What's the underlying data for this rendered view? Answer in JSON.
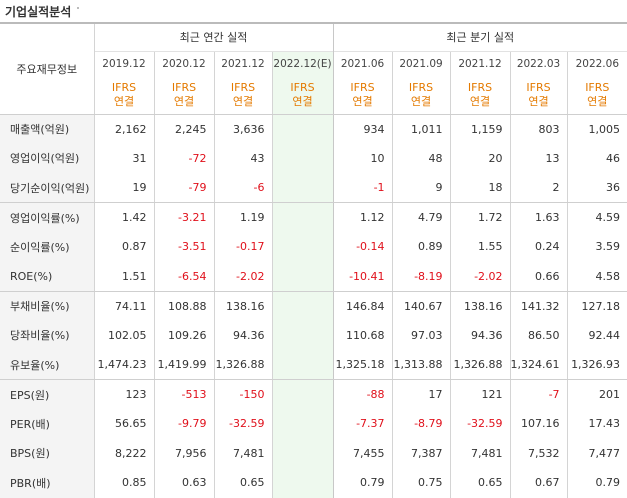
{
  "section_title": "기업실적분석",
  "corner_label": "주요재무정보",
  "annual_header": "최근 연간 실적",
  "quarter_header": "최근 분기 실적",
  "annual_periods": [
    "2019.12",
    "2020.12",
    "2021.12",
    "2022.12(E)"
  ],
  "quarter_periods": [
    "2021.06",
    "2021.09",
    "2021.12",
    "2022.03",
    "2022.06"
  ],
  "ifrs_top": "IFRS",
  "ifrs_bottom": "연결",
  "rows": [
    {
      "label": "매출액(억원)",
      "annual": [
        "2,162",
        "2,245",
        "3,636",
        ""
      ],
      "quarter": [
        "934",
        "1,011",
        "1,159",
        "803",
        "1,005"
      ]
    },
    {
      "label": "영업이익(억원)",
      "annual": [
        "31",
        "-72",
        "43",
        ""
      ],
      "quarter": [
        "10",
        "48",
        "20",
        "13",
        "46"
      ]
    },
    {
      "label": "당기순이익(억원)",
      "annual": [
        "19",
        "-79",
        "-6",
        ""
      ],
      "quarter": [
        "-1",
        "9",
        "18",
        "2",
        "36"
      ]
    },
    {
      "label": "영업이익률(%)",
      "annual": [
        "1.42",
        "-3.21",
        "1.19",
        ""
      ],
      "quarter": [
        "1.12",
        "4.79",
        "1.72",
        "1.63",
        "4.59"
      ]
    },
    {
      "label": "순이익률(%)",
      "annual": [
        "0.87",
        "-3.51",
        "-0.17",
        ""
      ],
      "quarter": [
        "-0.14",
        "0.89",
        "1.55",
        "0.24",
        "3.59"
      ]
    },
    {
      "label": "ROE(%)",
      "annual": [
        "1.51",
        "-6.54",
        "-2.02",
        ""
      ],
      "quarter": [
        "-10.41",
        "-8.19",
        "-2.02",
        "0.66",
        "4.58"
      ]
    },
    {
      "label": "부채비율(%)",
      "annual": [
        "74.11",
        "108.88",
        "138.16",
        ""
      ],
      "quarter": [
        "146.84",
        "140.67",
        "138.16",
        "141.32",
        "127.18"
      ]
    },
    {
      "label": "당좌비율(%)",
      "annual": [
        "102.05",
        "109.26",
        "94.36",
        ""
      ],
      "quarter": [
        "110.68",
        "97.03",
        "94.36",
        "86.50",
        "92.44"
      ]
    },
    {
      "label": "유보율(%)",
      "annual": [
        "1,474.23",
        "1,419.99",
        "1,326.88",
        ""
      ],
      "quarter": [
        "1,325.18",
        "1,313.88",
        "1,326.88",
        "1,324.61",
        "1,326.93"
      ]
    },
    {
      "label": "EPS(원)",
      "annual": [
        "123",
        "-513",
        "-150",
        ""
      ],
      "quarter": [
        "-88",
        "17",
        "121",
        "-7",
        "201"
      ]
    },
    {
      "label": "PER(배)",
      "annual": [
        "56.65",
        "-9.79",
        "-32.59",
        ""
      ],
      "quarter": [
        "-7.37",
        "-8.79",
        "-32.59",
        "107.16",
        "17.43"
      ]
    },
    {
      "label": "BPS(원)",
      "annual": [
        "8,222",
        "7,956",
        "7,481",
        ""
      ],
      "quarter": [
        "7,455",
        "7,387",
        "7,481",
        "7,532",
        "7,477"
      ]
    },
    {
      "label": "PBR(배)",
      "annual": [
        "0.85",
        "0.63",
        "0.65",
        ""
      ],
      "quarter": [
        "0.79",
        "0.75",
        "0.65",
        "0.67",
        "0.79"
      ]
    }
  ]
}
